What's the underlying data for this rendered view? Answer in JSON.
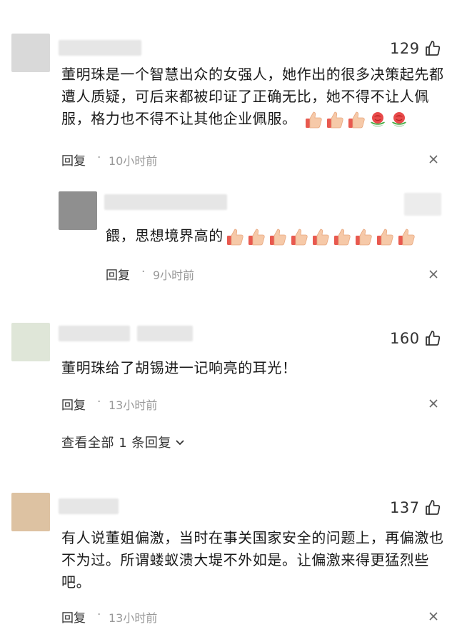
{
  "comments": [
    {
      "avatar_color": "#d9d9d9",
      "likes": "129",
      "text": "董明珠是一个智慧出众的女强人，她作出的很多决策起先都遭人质疑，可后来都被印证了正确无比，她不得不让人佩服，格力也不得不让其他企业佩服。",
      "emojis": [
        "thumbs-up",
        "thumbs-up",
        "thumbs-up",
        "rose",
        "rose"
      ],
      "reply_label": "回复",
      "dot": "·",
      "time": "10小时前"
    },
    {
      "avatar_color": "#8f8f8f",
      "text": "餵，思想境界高的",
      "emojis": [
        "thumbs-up",
        "thumbs-up",
        "thumbs-up",
        "thumbs-up",
        "thumbs-up",
        "thumbs-up",
        "thumbs-up",
        "thumbs-up",
        "thumbs-up"
      ],
      "reply_label": "回复",
      "dot": "·",
      "time": "9小时前"
    },
    {
      "avatar_color": "#dfe6d8",
      "likes": "160",
      "text": "董明珠给了胡锡进一记响亮的耳光！",
      "reply_label": "回复",
      "dot": "·",
      "time": "13小时前",
      "expand_label": "查看全部 1 条回复"
    },
    {
      "avatar_color": "#ddc2a2",
      "likes": "137",
      "text": "有人说董姐偏激，当时在事关国家安全的问题上，再偏激也不为过。所谓蝼蚁溃大堤不外如是。让偏激来得更猛烈些吧。",
      "reply_label": "回复",
      "dot": "·",
      "time": "13小时前"
    }
  ],
  "icons": {
    "like": "thumbs-up-outline-icon",
    "close": "close-x-icon",
    "chevron": "chevron-down-icon"
  }
}
